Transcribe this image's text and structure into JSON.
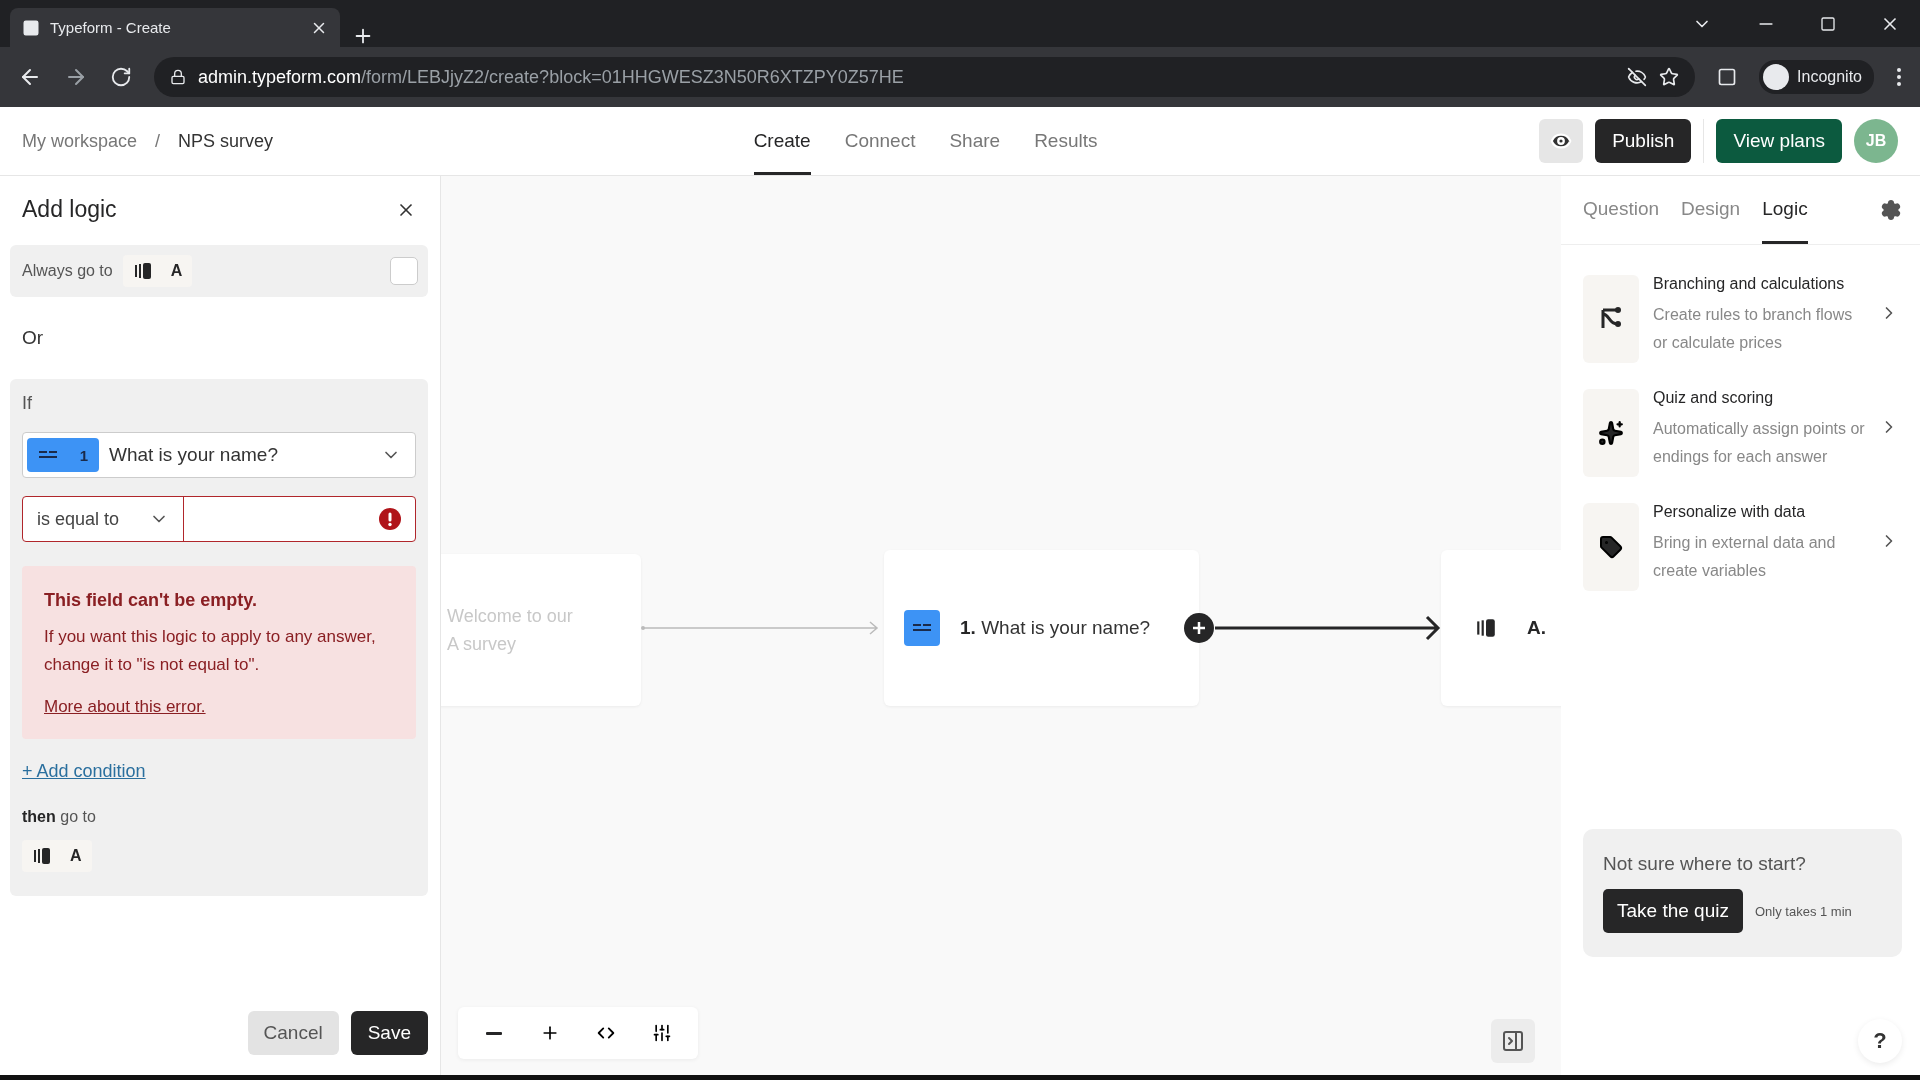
{
  "browser": {
    "tab_title": "Typeform - Create",
    "url_host": "admin.typeform.com",
    "url_path": "/form/LEBJjyZ2/create?block=01HHGWESZ3N50R6XTZPY0Z57HE",
    "profile": "Incognito"
  },
  "breadcrumb": [
    "My workspace",
    "NPS survey"
  ],
  "breadcrumb_separator": "/",
  "nav_tabs": [
    {
      "label": "Create",
      "selected": true
    },
    {
      "label": "Connect",
      "selected": false
    },
    {
      "label": "Share",
      "selected": false
    },
    {
      "label": "Results",
      "selected": false
    }
  ],
  "header_buttons": {
    "publish": "Publish",
    "plans": "View plans",
    "avatar": "JB"
  },
  "logic_panel": {
    "title": "Add logic",
    "always": {
      "label": "Always go to",
      "target": "A",
      "checked": false
    },
    "or_label": "Or",
    "if_label": "If",
    "question": {
      "number": "1",
      "text": "What is your name?"
    },
    "operator": "is equal to",
    "value_error": true,
    "error": {
      "title": "This field can't be empty.",
      "message": "If you want this logic to apply to any answer, change it to \"is not equal to\".",
      "link": "More about this error."
    },
    "add_condition": "+ Add condition",
    "then_label": "**then** go to",
    "then_target": "A",
    "buttons": {
      "cancel": "Cancel",
      "save": "Save"
    }
  },
  "canvas": {
    "welcome": "Welcome to our A survey",
    "question_number": "1.",
    "question_text": "What is your name?",
    "ending": "A."
  },
  "side_tabs": [
    {
      "label": "Question",
      "selected": false
    },
    {
      "label": "Design",
      "selected": false
    },
    {
      "label": "Logic",
      "selected": true
    }
  ],
  "features": [
    {
      "kind": "branch",
      "title": "Branching and calculations",
      "text": "Create rules to branch flows or calculate prices"
    },
    {
      "kind": "sparkle",
      "title": "Quiz and scoring",
      "text": "Automatically assign points or endings for each answer"
    },
    {
      "kind": "tag",
      "title": "Personalize with data",
      "text": "Bring in external data and create variables"
    }
  ],
  "quiz": {
    "prompt": "Not sure where to start?",
    "button": "Take the quiz",
    "note": "Only takes 1 min"
  },
  "help": "?"
}
